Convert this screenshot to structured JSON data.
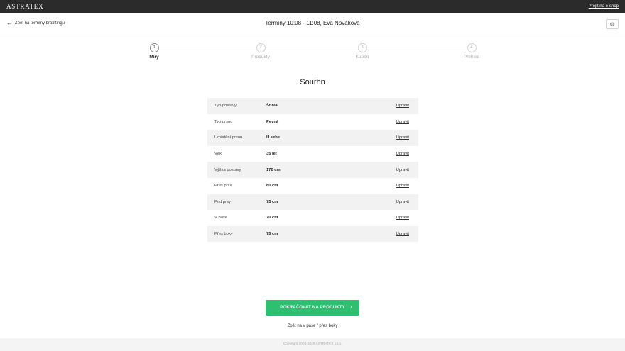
{
  "topbar": {
    "brand": "ASTRATEX",
    "eshop_link": "Přejít na e-shop"
  },
  "header": {
    "back_label": "Zpět na termíny brafittingu",
    "back_icon": "arrow-left-icon",
    "title": "Termíny 10:08 - 11:08, Eva Nováková",
    "settings_icon": "gear-icon"
  },
  "stepper": {
    "steps": [
      {
        "number": "1",
        "label": "Míry"
      },
      {
        "number": "2",
        "label": "Produkty"
      },
      {
        "number": "3",
        "label": "Kupón"
      },
      {
        "number": "4",
        "label": "Přehled"
      }
    ],
    "active": 0
  },
  "summary": {
    "title": "Sourhn",
    "edit_label": "Upravit",
    "rows": [
      {
        "key": "Typ postavy",
        "value": "Štíhlá"
      },
      {
        "key": "Typ prsou",
        "value": "Pevná"
      },
      {
        "key": "Umístění prsou",
        "value": "U sebe"
      },
      {
        "key": "Věk",
        "value": "35 let"
      },
      {
        "key": "Výška postavy",
        "value": "170 cm"
      },
      {
        "key": "Přes prsa",
        "value": "80 cm"
      },
      {
        "key": "Pod prsy",
        "value": "75 cm"
      },
      {
        "key": "V pase",
        "value": "70 cm"
      },
      {
        "key": "Přes boky",
        "value": "75 cm"
      }
    ]
  },
  "actions": {
    "continue_label": "POKRAČOVAT NA PRODUKTY",
    "continue_icon": "chevron-right-icon",
    "back_label": "Zpět na v pase / přes boky"
  },
  "footer": {
    "copyright": "Copyright 2005-2020 ASTRATEX s.r.o."
  },
  "colors": {
    "accent": "#2fbf71",
    "topbar": "#2b2b2b"
  }
}
